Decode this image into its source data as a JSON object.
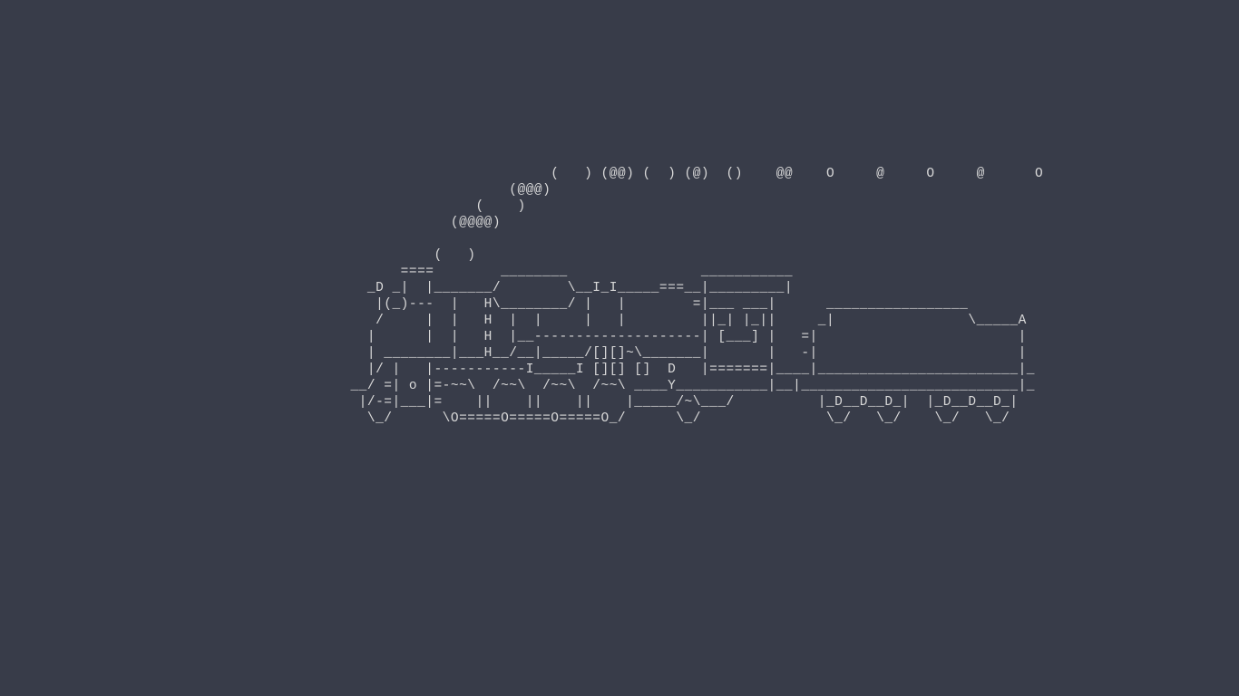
{
  "terminal": {
    "background": "#383c49",
    "foreground": "#d8d8d8",
    "program": "sl",
    "ascii_art_lines": [
      "                                                                  (   ) (@@) (  ) (@)  ()    @@    O     @     O     @      O",
      "                                                             (@@@)",
      "                                                         (    )",
      "                                                      (@@@@)",
      "",
      "                                                    (   )",
      "                                                ====        ________                ___________",
      "                                            _D _|  |_______/        \\__I_I_____===__|_________|",
      "                                             |(_)---  |   H\\________/ |   |        =|___ ___|      _________________",
      "                                             /     |  |   H  |  |     |   |         ||_| |_||     _|                \\_____A",
      "                                            |      |  |   H  |__--------------------| [___] |   =|                        |",
      "                                            | ________|___H__/__|_____/[][]~\\_______|       |   -|                        |",
      "                                            |/ |   |-----------I_____I [][] []  D   |=======|____|________________________|_",
      "                                          __/ =| o |=-~~\\  /~~\\  /~~\\  /~~\\ ____Y___________|__|__________________________|_",
      "                                           |/-=|___|=    ||    ||    ||    |_____/~\\___/          |_D__D__D_|  |_D__D__D_|",
      "                                            \\_/      \\O=====O=====O=====O_/      \\_/               \\_/   \\_/    \\_/   \\_/"
    ]
  }
}
